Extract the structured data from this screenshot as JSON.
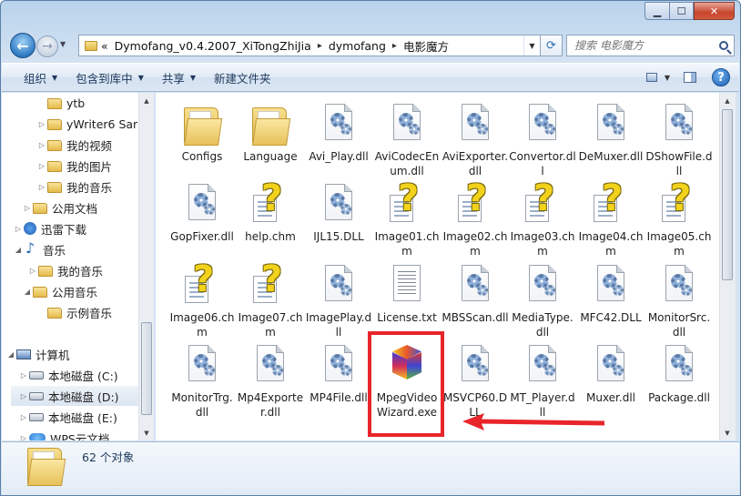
{
  "window": {
    "controls": {
      "minimize": "▁",
      "maximize": "☐",
      "close": "✕"
    }
  },
  "nav": {
    "back": "←",
    "forward": "→",
    "history": "▼",
    "address_segments": [
      "Dymofang_v0.4.2007_XiTongZhiJia",
      "dymofang",
      "电影魔方"
    ],
    "address_separator": "▸",
    "address_prefix": "«",
    "refresh": "⟳",
    "search_placeholder": "搜索 电影魔方"
  },
  "toolbar": {
    "organize": "组织",
    "include_in_library": "包含到库中",
    "share": "共享",
    "new_folder": "新建文件夹",
    "help": "?"
  },
  "tree": [
    {
      "label": "ytb",
      "icon": "folder",
      "twisty": ""
    },
    {
      "label": "yWriter6 Sar",
      "icon": "folder",
      "twisty": "▷"
    },
    {
      "label": "我的视频",
      "icon": "folder",
      "twisty": "▷"
    },
    {
      "label": "我的图片",
      "icon": "folder",
      "twisty": "▷"
    },
    {
      "label": "我的音乐",
      "icon": "folder",
      "twisty": "▷"
    },
    {
      "label": "公用文档",
      "icon": "folder",
      "twisty": "▷"
    },
    {
      "label": "迅雷下载",
      "icon": "dl",
      "twisty": "▷"
    },
    {
      "label": "音乐",
      "icon": "music",
      "twisty": "◢"
    },
    {
      "label": "我的音乐",
      "icon": "folder",
      "twisty": "▷"
    },
    {
      "label": "公用音乐",
      "icon": "folder",
      "twisty": "◢"
    },
    {
      "label": "示例音乐",
      "icon": "folder",
      "twisty": ""
    },
    {
      "label": "计算机",
      "icon": "pc",
      "twisty": "◢"
    },
    {
      "label": "本地磁盘 (C:)",
      "icon": "drive",
      "twisty": "▷"
    },
    {
      "label": "本地磁盘 (D:)",
      "icon": "drive",
      "twisty": "▷"
    },
    {
      "label": "本地磁盘 (E:)",
      "icon": "drive",
      "twisty": "▷"
    },
    {
      "label": "WPS云文档",
      "icon": "cloud",
      "twisty": "▷"
    }
  ],
  "files": [
    {
      "name": "Configs",
      "type": "folder"
    },
    {
      "name": "Language",
      "type": "folder"
    },
    {
      "name": "Avi_Play.dll",
      "type": "dll"
    },
    {
      "name": "AviCodecEnum.dll",
      "type": "dll"
    },
    {
      "name": "AviExporter.dll",
      "type": "dll"
    },
    {
      "name": "Convertor.dll",
      "type": "dll"
    },
    {
      "name": "DeMuxer.dll",
      "type": "dll"
    },
    {
      "name": "DShowFile.dll",
      "type": "dll"
    },
    {
      "name": "GopFixer.dll",
      "type": "dll"
    },
    {
      "name": "help.chm",
      "type": "chm"
    },
    {
      "name": "IJL15.DLL",
      "type": "dll"
    },
    {
      "name": "Image01.chm",
      "type": "chm"
    },
    {
      "name": "Image02.chm",
      "type": "chm"
    },
    {
      "name": "Image03.chm",
      "type": "chm"
    },
    {
      "name": "Image04.chm",
      "type": "chm"
    },
    {
      "name": "Image05.chm",
      "type": "chm"
    },
    {
      "name": "Image06.chm",
      "type": "chm"
    },
    {
      "name": "Image07.chm",
      "type": "chm"
    },
    {
      "name": "ImagePlay.dll",
      "type": "dll"
    },
    {
      "name": "License.txt",
      "type": "txt"
    },
    {
      "name": "MBSScan.dll",
      "type": "dll"
    },
    {
      "name": "MediaType.dll",
      "type": "dll"
    },
    {
      "name": "MFC42.DLL",
      "type": "dll"
    },
    {
      "name": "MonitorSrc.dll",
      "type": "dll"
    },
    {
      "name": "MonitorTrg.dll",
      "type": "dll"
    },
    {
      "name": "Mp4Exporter.dll",
      "type": "dll"
    },
    {
      "name": "MP4File.dll",
      "type": "dll"
    },
    {
      "name": "MpegVideoWizard.exe",
      "type": "exe"
    },
    {
      "name": "MSVCP60.DLL",
      "type": "dll"
    },
    {
      "name": "MT_Player.dll",
      "type": "dll"
    },
    {
      "name": "Muxer.dll",
      "type": "dll"
    },
    {
      "name": "Package.dll",
      "type": "dll"
    }
  ],
  "status": {
    "count_text": "62 个对象"
  },
  "colors": {
    "highlight": "#e8252a",
    "arrow": "#e8252a"
  }
}
